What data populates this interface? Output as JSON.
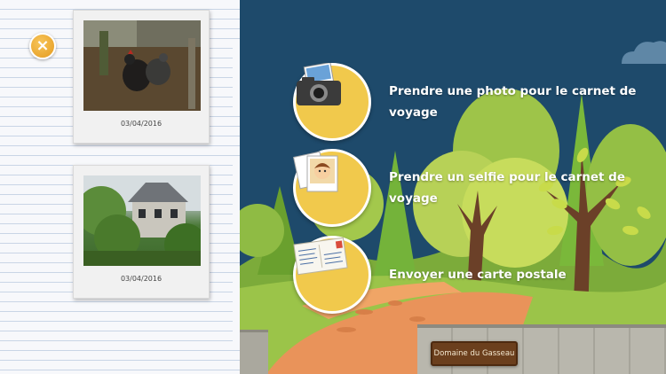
{
  "close_button": {
    "icon": "close-icon",
    "glyph": "×"
  },
  "gallery": {
    "photos": [
      {
        "subject": "hens",
        "date": "03/04/2016"
      },
      {
        "subject": "house",
        "date": "03/04/2016"
      }
    ]
  },
  "menu": {
    "items": [
      {
        "icon": "camera-icon",
        "label": "Prendre une photo pour le carnet de voyage"
      },
      {
        "icon": "selfie-icon",
        "label": "Prendre un selfie pour le carnet de voyage"
      },
      {
        "icon": "postcard-icon",
        "label": "Envoyer une carte postale"
      }
    ]
  },
  "location_sign": {
    "label": "Domaine du Gasseau"
  },
  "colors": {
    "menu_circle": "#f1c94c",
    "sky": "#1e4a6b",
    "path": "#e9935a",
    "notebook_lines": "#c9d5e6"
  }
}
